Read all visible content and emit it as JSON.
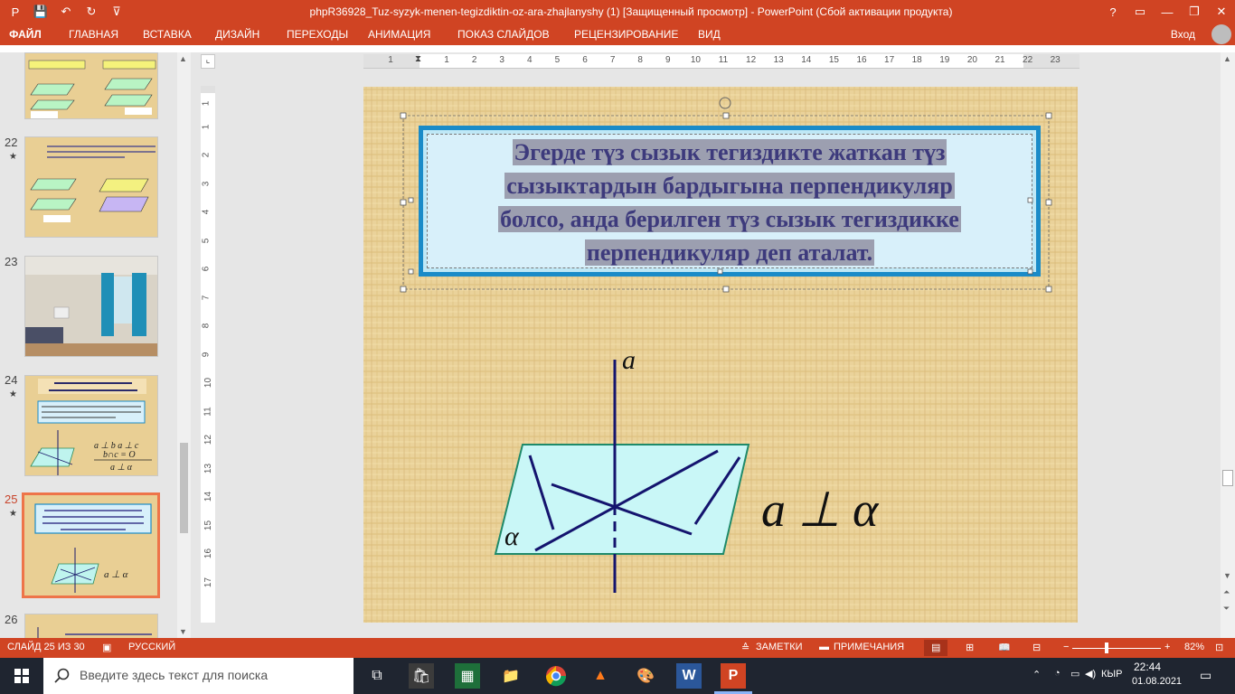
{
  "window": {
    "title": "phpR36928_Tuz-syzyk-menen-tegizdiktin-oz-ara-zhajlanyshy (1) [Защищенный просмотр] -  PowerPoint (Сбой активации продукта)",
    "help": "?",
    "minimize": "—",
    "restore": "❐",
    "close": "✕"
  },
  "qat": {
    "save": "💾",
    "undo": "↶",
    "redo": "↻",
    "customize": "⊽"
  },
  "ribbon": {
    "file_tab": "ФАЙЛ",
    "tabs": [
      "ГЛАВНАЯ",
      "ВСТАВКА",
      "ДИЗАЙН",
      "ПЕРЕХОДЫ",
      "АНИМАЦИЯ",
      "ПОКАЗ СЛАЙДОВ",
      "РЕЦЕНЗИРОВАНИЕ",
      "ВИД"
    ],
    "login": "Вход"
  },
  "thumbnails": [
    {
      "num": "22"
    },
    {
      "num": "23"
    },
    {
      "num": "24",
      "title": "Түз сызык жана тегиздиктин перпендикулярдык белгилери.",
      "formula": "a ⊥ b, a ⊥ c, b∩c = O, a ⊥ α"
    },
    {
      "num": "25",
      "text": "Эгерде түз сызык тегиздикте жаткан түз сызыктардын бардыгына перпендикуляр болсо, анда берилген түз сызык тегиздикке перпендикуляр деп аталат.",
      "formula": "a ⊥ α"
    },
    {
      "num": "26"
    }
  ],
  "hruler": [
    "1",
    "1",
    "2",
    "3",
    "4",
    "5",
    "6",
    "7",
    "8",
    "9",
    "10",
    "11",
    "12",
    "13",
    "14",
    "15",
    "16",
    "17",
    "18",
    "19",
    "20",
    "21",
    "22",
    "23"
  ],
  "vruler": [
    "1",
    "1",
    "2",
    "3",
    "4",
    "5",
    "6",
    "7",
    "8",
    "9",
    "10",
    "11",
    "12",
    "13",
    "14",
    "15",
    "16",
    "17"
  ],
  "slide": {
    "lines": [
      "Эгерде түз сызык тегиздикте жаткан түз",
      "сызыктардын бардыгына перпендикуляр",
      "болсо, анда берилген түз сызык тегиздикке",
      "перпендикуляр деп аталат."
    ],
    "label_a": "a",
    "label_alpha": "α",
    "formula": "a ⊥ α"
  },
  "status": {
    "slide": "СЛАЙД 25 ИЗ 30",
    "lang": "РУССКИЙ",
    "notes": "ЗАМЕТКИ",
    "comments": "ПРИМЕЧАНИЯ",
    "zoom": "82%"
  },
  "taskbar": {
    "search_placeholder": "Введите здесь текст для поиска",
    "lang": "КЫР",
    "time": "22:44",
    "date": "01.08.2021"
  }
}
